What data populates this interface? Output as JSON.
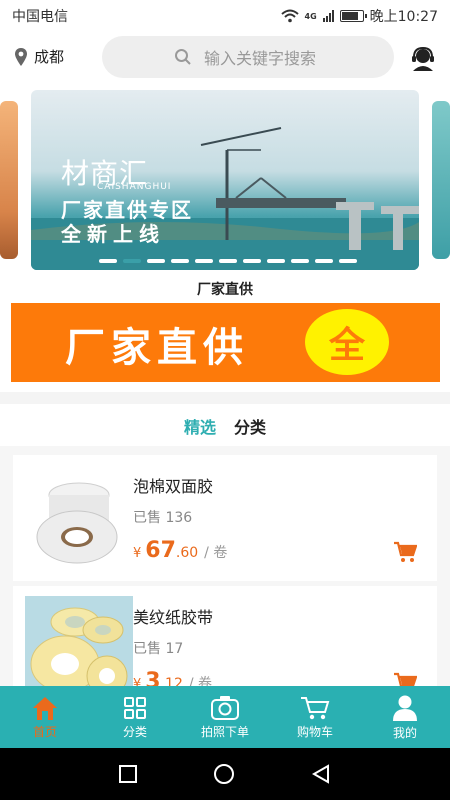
{
  "status_bar": {
    "carrier": "中国电信",
    "network": "4G",
    "time": "晚上10:27",
    "battery_level": 0.8
  },
  "header": {
    "location": "成都",
    "search": {
      "placeholder": "输入关键字搜索"
    }
  },
  "banner": {
    "logo_text": "材商汇",
    "logo_sub": "CAISHANGHUI",
    "line1": "厂家直供专区",
    "line2": "全新上线",
    "slide_count": 11,
    "active_slide": 1
  },
  "section_title": "厂家直供",
  "promo": {
    "text": "厂家直供",
    "badge": "全"
  },
  "tabs": [
    {
      "label": "精选",
      "active": true
    },
    {
      "label": "分类",
      "active": false
    }
  ],
  "products": [
    {
      "name": "泡棉双面胶",
      "sold": "已售 136",
      "currency": "¥",
      "price_int": "67",
      "price_dec": ".60",
      "unit": "/ 卷"
    },
    {
      "name": "美纹纸胶带",
      "sold": "已售 17",
      "currency": "¥",
      "price_int": "3",
      "price_dec": ".12",
      "unit": "/ 卷"
    }
  ],
  "bottom_nav": [
    {
      "label": "首页",
      "icon": "home-icon",
      "active": true
    },
    {
      "label": "分类",
      "icon": "grid-icon",
      "active": false
    },
    {
      "label": "拍照下单",
      "icon": "camera-icon",
      "active": false
    },
    {
      "label": "购物车",
      "icon": "cart-icon",
      "active": false
    },
    {
      "label": "我的",
      "icon": "user-icon",
      "active": false
    }
  ],
  "colors": {
    "accent": "#2ab0b2",
    "price": "#ea6a1c",
    "promo": "#fd7a0a",
    "promo_badge": "#fff200"
  }
}
